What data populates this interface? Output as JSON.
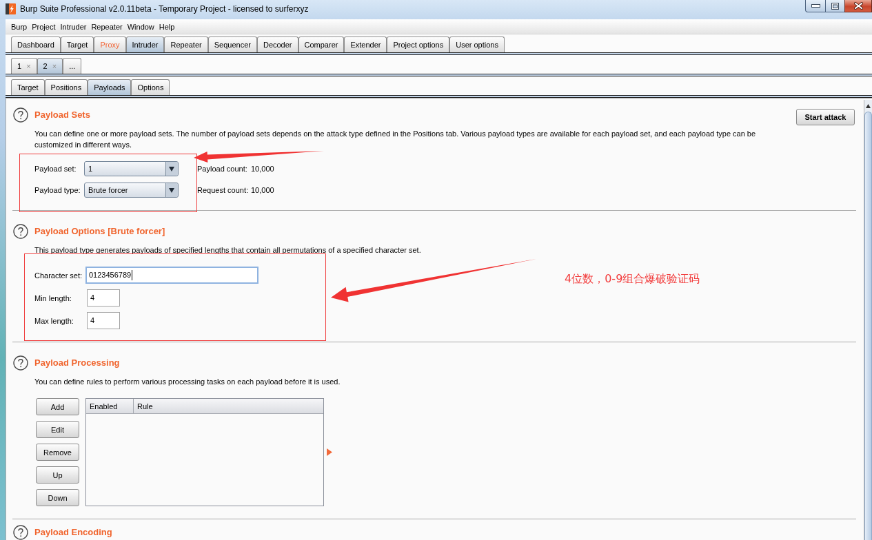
{
  "window": {
    "title": "Burp Suite Professional v2.0.11beta - Temporary Project - licensed to surferxyz"
  },
  "menu": [
    "Burp",
    "Project",
    "Intruder",
    "Repeater",
    "Window",
    "Help"
  ],
  "main_tabs": [
    {
      "label": "Dashboard",
      "selected": false,
      "highlighted": false
    },
    {
      "label": "Target",
      "selected": false,
      "highlighted": false
    },
    {
      "label": "Proxy",
      "selected": false,
      "highlighted": true
    },
    {
      "label": "Intruder",
      "selected": true,
      "highlighted": false
    },
    {
      "label": "Repeater",
      "selected": false,
      "highlighted": false
    },
    {
      "label": "Sequencer",
      "selected": false,
      "highlighted": false
    },
    {
      "label": "Decoder",
      "selected": false,
      "highlighted": false
    },
    {
      "label": "Comparer",
      "selected": false,
      "highlighted": false
    },
    {
      "label": "Extender",
      "selected": false,
      "highlighted": false
    },
    {
      "label": "Project options",
      "selected": false,
      "highlighted": false
    },
    {
      "label": "User options",
      "selected": false,
      "highlighted": false
    }
  ],
  "attack_tabs": [
    {
      "label": "1",
      "close": "×",
      "selected": false
    },
    {
      "label": "2",
      "close": "×",
      "selected": true
    },
    {
      "label": "...",
      "selected": false
    }
  ],
  "sub_tabs": [
    {
      "label": "Target",
      "selected": false
    },
    {
      "label": "Positions",
      "selected": false
    },
    {
      "label": "Payloads",
      "selected": true
    },
    {
      "label": "Options",
      "selected": false
    }
  ],
  "sections": [
    {
      "kind": "sets",
      "title": "Payload Sets",
      "description": "You can define one or more payload sets. The number of payload sets depends on the attack type defined in the Positions tab. Various payload types are available for each payload set, and each payload type can be customized in different ways.",
      "action": "Start attack",
      "selectors": [
        {
          "label": "Payload set:",
          "value": "1"
        },
        {
          "label": "Payload type:",
          "value": "Brute forcer"
        }
      ],
      "counts": [
        {
          "label": "Payload count:",
          "value": "10,000"
        },
        {
          "label": "Request count:",
          "value": "10,000"
        }
      ]
    },
    {
      "kind": "options",
      "title": "Payload Options [Brute forcer]",
      "description": "This payload type generates payloads of specified lengths that contain all permutations of a specified character set.",
      "fields": [
        {
          "kind": "text",
          "label": "Character set:",
          "value": "0123456789",
          "focused": true
        },
        {
          "kind": "number",
          "label": "Min length:",
          "value": "4",
          "focused": false
        },
        {
          "kind": "number",
          "label": "Max length:",
          "value": "4",
          "focused": false
        }
      ]
    },
    {
      "kind": "processing",
      "title": "Payload Processing",
      "description": "You can define rules to perform various processing tasks on each payload before it is used.",
      "buttons": [
        "Add",
        "Edit",
        "Remove",
        "Up",
        "Down"
      ],
      "table": {
        "columns": [
          "Enabled",
          "Rule"
        ]
      }
    },
    {
      "kind": "encoding",
      "title": "Payload Encoding"
    }
  ],
  "annotation": {
    "note": "4位数，0-9组合爆破验证码"
  }
}
